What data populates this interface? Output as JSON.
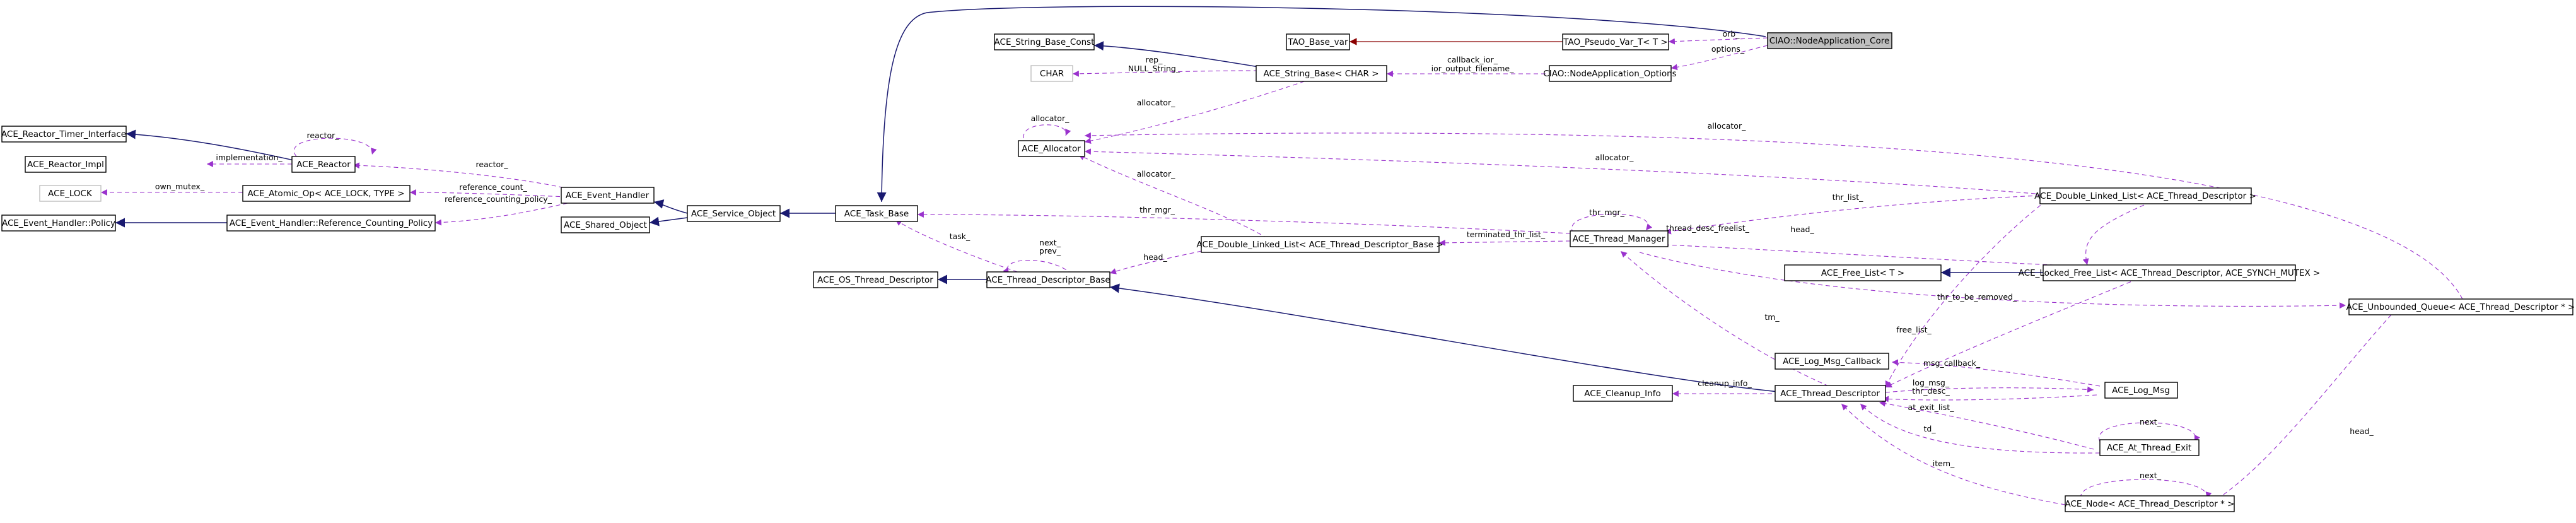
{
  "colors": {
    "inheritance": "#191970",
    "usage": "#9a32cd",
    "template": "#8b0000",
    "focus_fill": "#bfbfbf",
    "grey_border": "#bfbfbf"
  },
  "nodes": {
    "ciao_core": "CIAO::NodeApplication_Core",
    "tao_pseudo": "TAO_Pseudo_Var_T< T >",
    "tao_base_var": "TAO_Base_var",
    "ciao_options": "CIAO::NodeApplication_Options",
    "ace_string_base_const": "ACE_String_Base_Const",
    "char": "CHAR",
    "ace_string_base_char": "ACE_String_Base< CHAR >",
    "ace_allocator": "ACE_Allocator",
    "ace_reactor_timer": "ACE_Reactor_Timer_Interface",
    "ace_reactor_impl": "ACE_Reactor_Impl",
    "ace_reactor": "ACE_Reactor",
    "ace_lock": "ACE_LOCK",
    "ace_atomic_op": "ACE_Atomic_Op< ACE_LOCK, TYPE >",
    "ace_eh_policy": "ACE_Event_Handler::Policy",
    "ace_eh_refpolicy": "ACE_Event_Handler::Reference_Counting_Policy",
    "ace_event_handler": "ACE_Event_Handler",
    "ace_shared_object": "ACE_Shared_Object",
    "ace_service_object": "ACE_Service_Object",
    "ace_task_base": "ACE_Task_Base",
    "ace_os_thread_desc": "ACE_OS_Thread_Descriptor",
    "ace_thread_desc_base": "ACE_Thread_Descriptor_Base",
    "ace_dll_tdb": "ACE_Double_Linked_List< ACE_Thread_Descriptor_Base >",
    "ace_thread_manager": "ACE_Thread_Manager",
    "ace_dll_td": "ACE_Double_Linked_List< ACE_Thread_Descriptor >",
    "ace_free_list": "ACE_Free_List< T >",
    "ace_locked_free_list": "ACE_Locked_Free_List< ACE_Thread_Descriptor, ACE_SYNCH_MUTEX >",
    "ace_unbounded_queue": "ACE_Unbounded_Queue< ACE_Thread_Descriptor * >",
    "ace_log_msg_callback": "ACE_Log_Msg_Callback",
    "ace_cleanup_info": "ACE_Cleanup_Info",
    "ace_thread_descriptor": "ACE_Thread_Descriptor",
    "ace_log_msg": "ACE_Log_Msg",
    "ace_at_thread_exit": "ACE_At_Thread_Exit",
    "ace_node": "ACE_Node< ACE_Thread_Descriptor * >"
  },
  "edge_labels": {
    "orb": "orb_",
    "options": "options_",
    "callback_ior": "callback_ior_",
    "ior_output_filename": "ior_output_filename_",
    "rep": "rep_",
    "null_string": "NULL_String_",
    "allocator": "allocator_",
    "reactor": "reactor_",
    "implementation": "implementation_",
    "own_mutex": "own_mutex_",
    "reference_count": "reference_count_",
    "reference_counting_policy": "reference_counting_policy_",
    "thr_mgr": "thr_mgr_",
    "task": "task_",
    "next": "next_",
    "prev": "prev_",
    "head": "head_",
    "terminated_thr_list": "terminated_thr_list_",
    "thr_list": "thr_list_",
    "thread_desc_freelist": "thread_desc_freelist_",
    "thr_to_be_removed": "thr_to_be_removed_",
    "free_list": "free_list_",
    "tm": "tm_",
    "msg_callback": "msg_callback_",
    "cleanup_info": "cleanup_info_",
    "log_msg": "log_msg_",
    "thr_desc": "thr_desc_",
    "at_exit_list": "at_exit_list_",
    "td": "td_",
    "item": "item_"
  }
}
